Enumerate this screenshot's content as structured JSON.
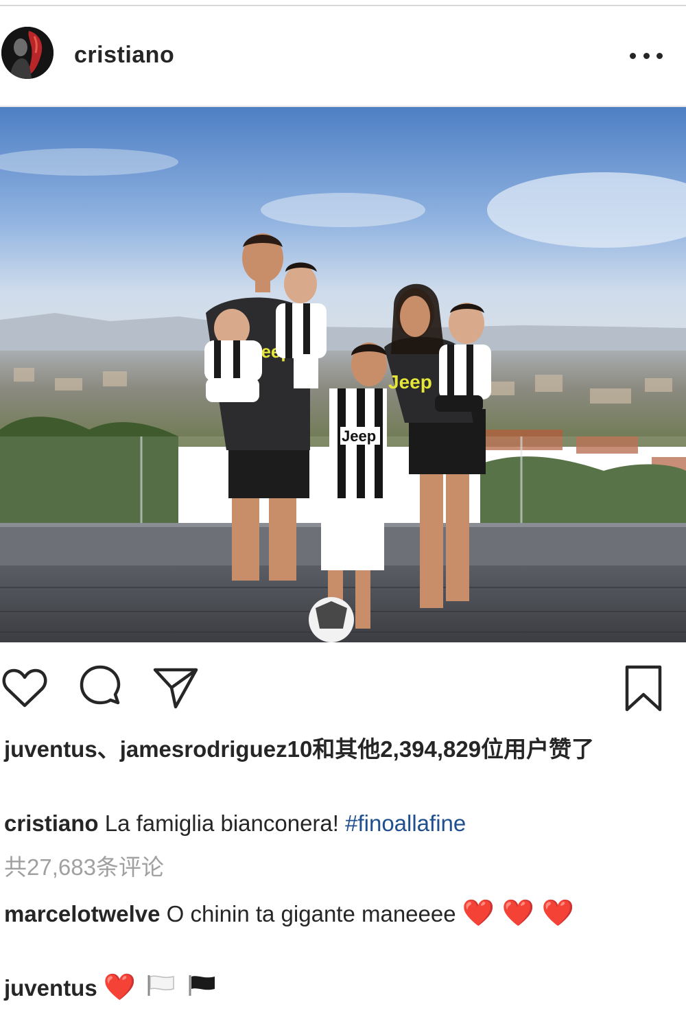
{
  "post": {
    "username": "cristiano",
    "likes_text": "juventus、jamesrodriguez10和其他2,394,829位用户赞了",
    "caption": {
      "username": "cristiano",
      "text": "La famiglia bianconera!",
      "hashtag": "#finoallafine"
    },
    "comments_count_text": "共27,683条评论",
    "comments": [
      {
        "username": "marcelotwelve",
        "text": "O chinin ta gigante maneeee",
        "hearts": "❤️ ❤️ ❤️"
      },
      {
        "username": "juventus",
        "text": "",
        "hearts": "❤️"
      }
    ]
  },
  "icons": {
    "more": "more-options-icon",
    "like": "heart-icon",
    "comment": "comment-icon",
    "share": "share-icon",
    "save": "bookmark-icon"
  },
  "photo_jersey_texts": [
    "Jeep",
    "Jeep",
    "Jeep",
    "Jeep"
  ],
  "colors": {
    "text": "#262626",
    "muted": "#a0a0a0",
    "hashtag": "#1f4f8f",
    "heart": "#e0252f"
  }
}
